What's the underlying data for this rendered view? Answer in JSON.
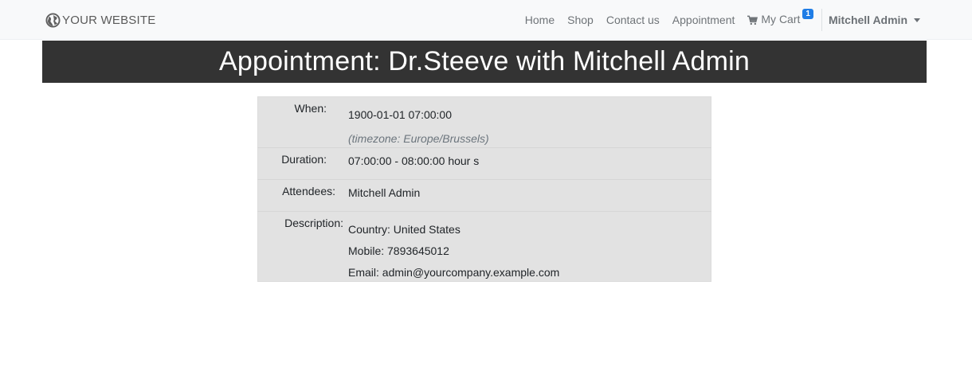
{
  "navbar": {
    "brand": "YOUR WEBSITE",
    "items": [
      {
        "label": "Home"
      },
      {
        "label": "Shop"
      },
      {
        "label": "Contact us"
      },
      {
        "label": "Appointment"
      }
    ],
    "cart": {
      "label": "My Cart",
      "count": "1",
      "icon": "shopping-cart-icon"
    },
    "user": {
      "label": "Mitchell Admin"
    }
  },
  "page": {
    "title": "Appointment: Dr.Steeve with Mitchell Admin"
  },
  "details": {
    "when": {
      "label": "When:",
      "value": "1900-01-01 07:00:00",
      "timezone": "(timezone: Europe/Brussels)"
    },
    "duration": {
      "label": "Duration:",
      "value": "07:00:00 - 08:00:00 hour s"
    },
    "attendees": {
      "label": "Attendees:",
      "value": "Mitchell Admin"
    },
    "description": {
      "label": "Description:",
      "lines": [
        "Country: United States",
        "Mobile: 7893645012",
        "Email: admin@yourcompany.example.com"
      ]
    }
  },
  "colors": {
    "navbar_bg": "#f8f9fa",
    "title_bg": "#333333",
    "table_bg": "#e2e2e2",
    "badge": "#1f7de6"
  }
}
